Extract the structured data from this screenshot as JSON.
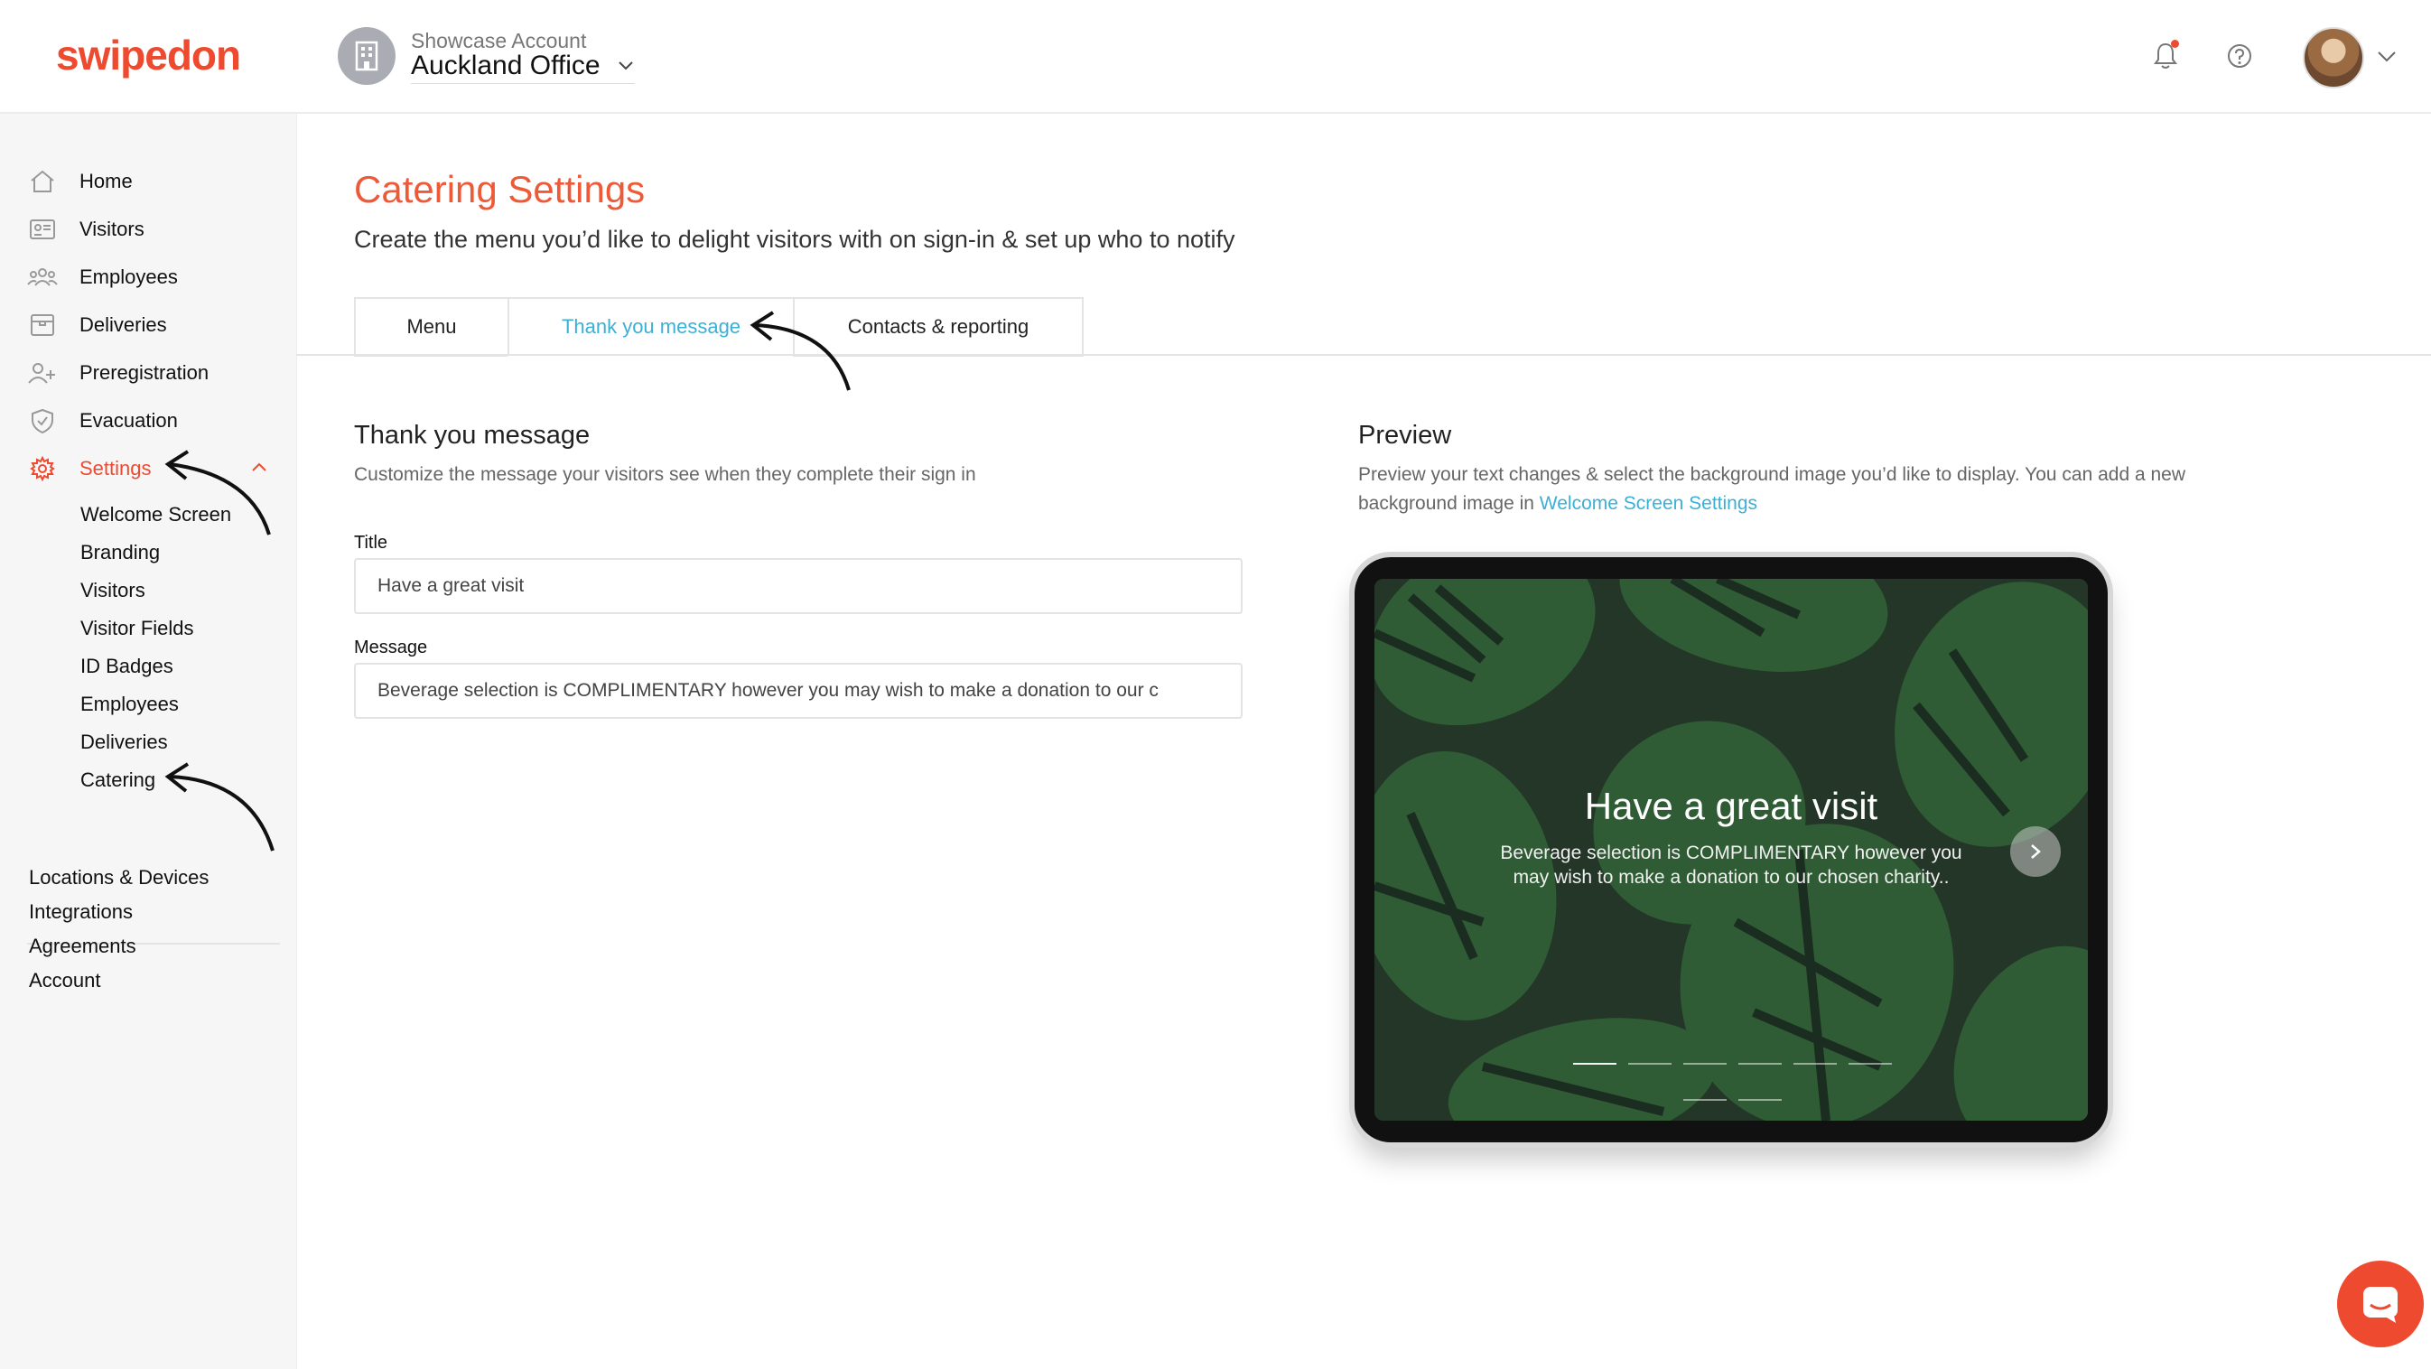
{
  "brand": {
    "logo_text": "swipedon",
    "accent": "#ee4a2f",
    "link": "#3bb0d6"
  },
  "header": {
    "account_label": "Showcase Account",
    "location_name": "Auckland Office",
    "icons": [
      "building-icon",
      "chevron-down-icon",
      "bell-icon",
      "help-icon",
      "avatar",
      "chevron-down-icon"
    ]
  },
  "sidebar": {
    "items": [
      {
        "label": "Home",
        "icon": "home-icon"
      },
      {
        "label": "Visitors",
        "icon": "visitor-card-icon"
      },
      {
        "label": "Employees",
        "icon": "employees-icon"
      },
      {
        "label": "Deliveries",
        "icon": "box-icon"
      },
      {
        "label": "Preregistration",
        "icon": "add-user-icon"
      },
      {
        "label": "Evacuation",
        "icon": "shield-icon"
      },
      {
        "label": "Settings",
        "icon": "gear-icon",
        "active": true,
        "expanded": true
      }
    ],
    "settings_sub": [
      "Welcome Screen",
      "Branding",
      "Visitors",
      "Visitor Fields",
      "ID Badges",
      "Employees",
      "Deliveries",
      "Catering"
    ],
    "bottom": [
      "Locations & Devices",
      "Integrations",
      "Agreements",
      "Account"
    ]
  },
  "page": {
    "title": "Catering Settings",
    "subtitle": "Create the menu you’d like to delight visitors with on sign-in & set up who to notify",
    "tabs": [
      {
        "label": "Menu"
      },
      {
        "label": "Thank you message",
        "active": true
      },
      {
        "label": "Contacts & reporting"
      }
    ]
  },
  "form": {
    "heading": "Thank you message",
    "description": "Customize the message your visitors see when they complete their sign in",
    "title_label": "Title",
    "title_value": "Have a great visit",
    "message_label": "Message",
    "message_value": "Beverage selection is COMPLIMENTARY however you may wish to make a donation to our c"
  },
  "preview": {
    "heading": "Preview",
    "desc_part1": "Preview your text changes & select the background image you’d like to display. You can add a new",
    "desc_part2": "background image in ",
    "desc_link": "Welcome Screen Settings",
    "screen_title": "Have a great visit",
    "screen_message": "Beverage selection is COMPLIMENTARY however you may wish to make a donation to our chosen charity..",
    "slide_count": 8,
    "active_slide": 1
  }
}
